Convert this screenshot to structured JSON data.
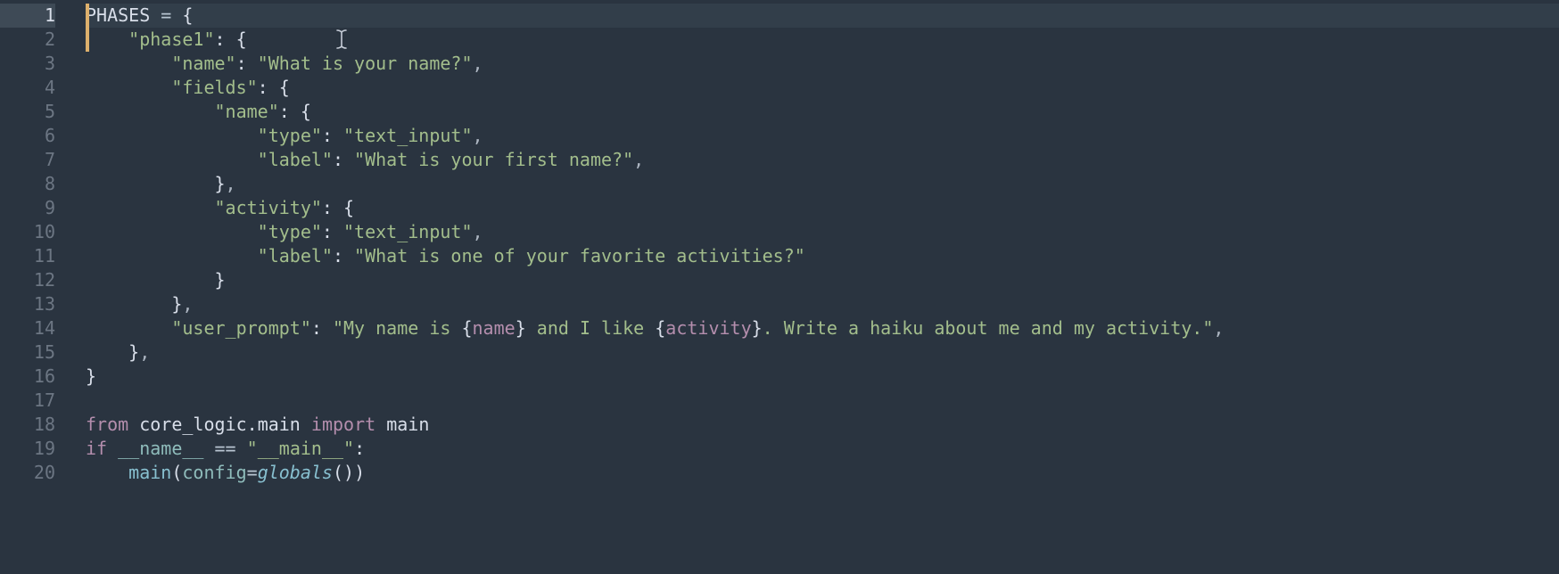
{
  "gutter": {
    "start": 1,
    "end": 20,
    "active": 1
  },
  "code": {
    "lines": [
      [
        {
          "c": "tok-var",
          "t": "PHASES"
        },
        {
          "c": "tok-sp",
          "t": " "
        },
        {
          "c": "tok-op",
          "t": "="
        },
        {
          "c": "tok-sp",
          "t": " "
        },
        {
          "c": "tok-punc",
          "t": "{"
        }
      ],
      [
        {
          "c": "tok-sp",
          "t": "    "
        },
        {
          "c": "tok-str",
          "t": "\"phase1\""
        },
        {
          "c": "tok-punc",
          "t": ":"
        },
        {
          "c": "tok-sp",
          "t": " "
        },
        {
          "c": "tok-punc",
          "t": "{"
        }
      ],
      [
        {
          "c": "tok-sp",
          "t": "        "
        },
        {
          "c": "tok-str",
          "t": "\"name\""
        },
        {
          "c": "tok-punc",
          "t": ":"
        },
        {
          "c": "tok-sp",
          "t": " "
        },
        {
          "c": "tok-str",
          "t": "\"What is your name?\""
        },
        {
          "c": "tok-comma",
          "t": ","
        }
      ],
      [
        {
          "c": "tok-sp",
          "t": "        "
        },
        {
          "c": "tok-str",
          "t": "\"fields\""
        },
        {
          "c": "tok-punc",
          "t": ":"
        },
        {
          "c": "tok-sp",
          "t": " "
        },
        {
          "c": "tok-punc",
          "t": "{"
        }
      ],
      [
        {
          "c": "tok-sp",
          "t": "            "
        },
        {
          "c": "tok-str",
          "t": "\"name\""
        },
        {
          "c": "tok-punc",
          "t": ":"
        },
        {
          "c": "tok-sp",
          "t": " "
        },
        {
          "c": "tok-punc",
          "t": "{"
        }
      ],
      [
        {
          "c": "tok-sp",
          "t": "                "
        },
        {
          "c": "tok-str",
          "t": "\"type\""
        },
        {
          "c": "tok-punc",
          "t": ":"
        },
        {
          "c": "tok-sp",
          "t": " "
        },
        {
          "c": "tok-str",
          "t": "\"text_input\""
        },
        {
          "c": "tok-comma",
          "t": ","
        }
      ],
      [
        {
          "c": "tok-sp",
          "t": "                "
        },
        {
          "c": "tok-str",
          "t": "\"label\""
        },
        {
          "c": "tok-punc",
          "t": ":"
        },
        {
          "c": "tok-sp",
          "t": " "
        },
        {
          "c": "tok-str",
          "t": "\"What is your first name?\""
        },
        {
          "c": "tok-comma",
          "t": ","
        }
      ],
      [
        {
          "c": "tok-sp",
          "t": "            "
        },
        {
          "c": "tok-punc",
          "t": "}"
        },
        {
          "c": "tok-comma",
          "t": ","
        }
      ],
      [
        {
          "c": "tok-sp",
          "t": "            "
        },
        {
          "c": "tok-str",
          "t": "\"activity\""
        },
        {
          "c": "tok-punc",
          "t": ":"
        },
        {
          "c": "tok-sp",
          "t": " "
        },
        {
          "c": "tok-punc",
          "t": "{"
        }
      ],
      [
        {
          "c": "tok-sp",
          "t": "                "
        },
        {
          "c": "tok-str",
          "t": "\"type\""
        },
        {
          "c": "tok-punc",
          "t": ":"
        },
        {
          "c": "tok-sp",
          "t": " "
        },
        {
          "c": "tok-str",
          "t": "\"text_input\""
        },
        {
          "c": "tok-comma",
          "t": ","
        }
      ],
      [
        {
          "c": "tok-sp",
          "t": "                "
        },
        {
          "c": "tok-str",
          "t": "\"label\""
        },
        {
          "c": "tok-punc",
          "t": ":"
        },
        {
          "c": "tok-sp",
          "t": " "
        },
        {
          "c": "tok-str",
          "t": "\"What is one of your favorite activities?\""
        }
      ],
      [
        {
          "c": "tok-sp",
          "t": "            "
        },
        {
          "c": "tok-punc",
          "t": "}"
        }
      ],
      [
        {
          "c": "tok-sp",
          "t": "        "
        },
        {
          "c": "tok-punc",
          "t": "}"
        },
        {
          "c": "tok-comma",
          "t": ","
        }
      ],
      [
        {
          "c": "tok-sp",
          "t": "        "
        },
        {
          "c": "tok-str",
          "t": "\"user_prompt\""
        },
        {
          "c": "tok-punc",
          "t": ":"
        },
        {
          "c": "tok-sp",
          "t": " "
        },
        {
          "c": "tok-str",
          "t": "\"My name is "
        },
        {
          "c": "tok-punc",
          "t": "{"
        },
        {
          "c": "tok-place",
          "t": "name"
        },
        {
          "c": "tok-punc",
          "t": "}"
        },
        {
          "c": "tok-str",
          "t": " and I like "
        },
        {
          "c": "tok-punc",
          "t": "{"
        },
        {
          "c": "tok-place",
          "t": "activity"
        },
        {
          "c": "tok-punc",
          "t": "}"
        },
        {
          "c": "tok-str",
          "t": ". Write a haiku about me and my activity.\""
        },
        {
          "c": "tok-comma",
          "t": ","
        }
      ],
      [
        {
          "c": "tok-sp",
          "t": "    "
        },
        {
          "c": "tok-punc",
          "t": "}"
        },
        {
          "c": "tok-comma",
          "t": ","
        }
      ],
      [
        {
          "c": "tok-punc",
          "t": "}"
        }
      ],
      [],
      [
        {
          "c": "tok-key",
          "t": "from"
        },
        {
          "c": "tok-sp",
          "t": " "
        },
        {
          "c": "tok-name",
          "t": "core_logic"
        },
        {
          "c": "tok-punc",
          "t": "."
        },
        {
          "c": "tok-name",
          "t": "main"
        },
        {
          "c": "tok-sp",
          "t": " "
        },
        {
          "c": "tok-key",
          "t": "import"
        },
        {
          "c": "tok-sp",
          "t": " "
        },
        {
          "c": "tok-name",
          "t": "main"
        }
      ],
      [
        {
          "c": "tok-key",
          "t": "if"
        },
        {
          "c": "tok-sp",
          "t": " "
        },
        {
          "c": "tok-mod",
          "t": "__name__"
        },
        {
          "c": "tok-sp",
          "t": " "
        },
        {
          "c": "tok-op",
          "t": "=="
        },
        {
          "c": "tok-sp",
          "t": " "
        },
        {
          "c": "tok-str",
          "t": "\"__main__\""
        },
        {
          "c": "tok-punc",
          "t": ":"
        }
      ],
      [
        {
          "c": "tok-sp",
          "t": "    "
        },
        {
          "c": "tok-call",
          "t": "main"
        },
        {
          "c": "tok-punc",
          "t": "("
        },
        {
          "c": "tok-mod",
          "t": "config"
        },
        {
          "c": "tok-op",
          "t": "="
        },
        {
          "c": "tok-italic",
          "t": "globals"
        },
        {
          "c": "tok-punc",
          "t": "()"
        },
        {
          "c": "tok-punc",
          "t": ")"
        }
      ]
    ],
    "activeLine": 1,
    "changeMarkers": [
      1,
      2
    ]
  }
}
